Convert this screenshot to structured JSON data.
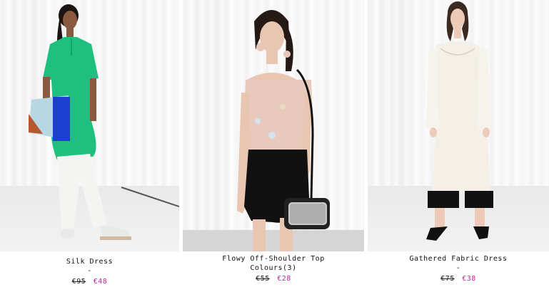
{
  "colors": {
    "sale_price": "#d01f8f"
  },
  "products": [
    {
      "name": "Silk Dress",
      "subtitle": "-",
      "old_price": "€95",
      "new_price": "€48"
    },
    {
      "name": "Flowy Off-Shoulder Top",
      "subtitle": "Colours(3)",
      "old_price": "€55",
      "new_price": "€28"
    },
    {
      "name": "Gathered Fabric Dress",
      "subtitle": "-",
      "old_price": "€75",
      "new_price": "€38"
    }
  ]
}
